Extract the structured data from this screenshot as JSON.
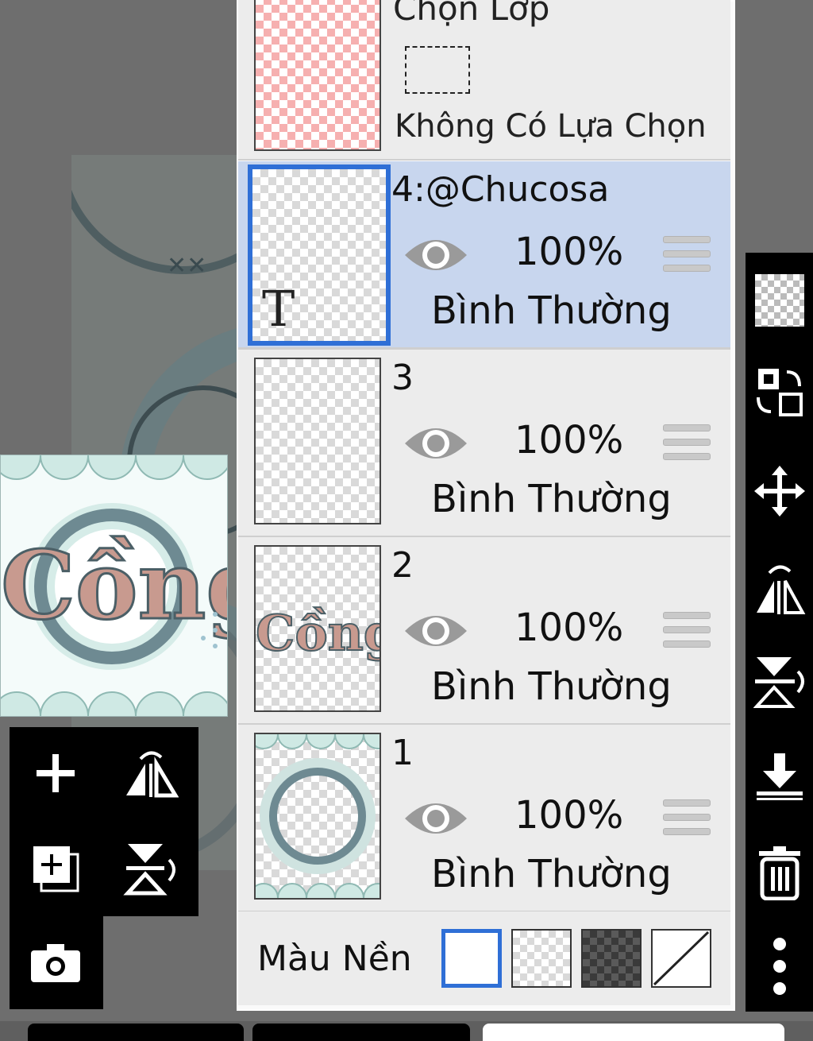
{
  "selection_layer": {
    "title": "Chọn Lớp",
    "status": "Không Có Lựa Chọn"
  },
  "layers": [
    {
      "name": "4:@Chucosa",
      "opacity": "100%",
      "blend": "Bình Thường",
      "active": true,
      "thumb_glyph": "T"
    },
    {
      "name": "3",
      "opacity": "100%",
      "blend": "Bình Thường",
      "active": false
    },
    {
      "name": "2",
      "opacity": "100%",
      "blend": "Bình Thường",
      "active": false
    },
    {
      "name": "1",
      "opacity": "100%",
      "blend": "Bình Thường",
      "active": false
    }
  ],
  "background": {
    "label": "Màu Nền",
    "options": [
      "white",
      "transparent",
      "dark-checker",
      "none"
    ],
    "selected": "white"
  },
  "left_tools": [
    "add-layer-icon",
    "flip-horizontal-icon",
    "duplicate-layer-icon",
    "flip-vertical-icon",
    "camera-icon"
  ],
  "right_tools": [
    "checker-icon",
    "swap-icon",
    "move-icon",
    "flip-horizontal-icon",
    "flip-vertical-icon",
    "merge-down-icon",
    "trash-icon",
    "more-icon"
  ],
  "colors": {
    "accent": "#2f6fd6",
    "active_row": "#c8d6ee",
    "panel": "#ececec",
    "toolbar": "#000000"
  }
}
